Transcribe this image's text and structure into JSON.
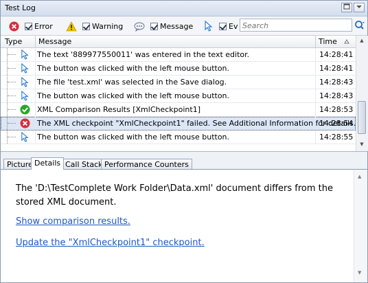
{
  "window": {
    "title": "Test Log"
  },
  "toolbar": {
    "filters": [
      {
        "label": "Error",
        "icon": "error-icon",
        "checked": true
      },
      {
        "label": "Warning",
        "icon": "warning-icon",
        "checked": true
      },
      {
        "label": "Message",
        "icon": "message-icon",
        "checked": true
      },
      {
        "label": "Ev",
        "icon": "event-icon",
        "checked": true
      }
    ],
    "search": {
      "placeholder": "Search",
      "value": ""
    }
  },
  "grid": {
    "columns": {
      "type": "Type",
      "message": "Message",
      "time": "Time"
    },
    "rows": [
      {
        "icon": "event-icon",
        "message": "The text '889977550011' was entered in the text editor.",
        "time": "14:28:41"
      },
      {
        "icon": "event-icon",
        "message": "The button was clicked with the left mouse button.",
        "time": "14:28:41"
      },
      {
        "icon": "event-icon",
        "message": "The file 'test.xml' was selected in the Save dialog.",
        "time": "14:28:43"
      },
      {
        "icon": "event-icon",
        "message": "The button was clicked with the left mouse button.",
        "time": "14:28:43"
      },
      {
        "icon": "checkpoint-pass-icon",
        "message": "XML Comparison Results [XmlCheckpoint1]",
        "time": "14:28:53"
      },
      {
        "icon": "error-icon",
        "message": "The XML checkpoint \"XmlCheckpoint1\" failed. See Additional Information for details.",
        "time": "14:28:54",
        "selected": true
      },
      {
        "icon": "event-icon",
        "message": "The button was clicked with the left mouse button.",
        "time": "14:28:55"
      }
    ]
  },
  "tabs": [
    {
      "label": "Picture"
    },
    {
      "label": "Details",
      "active": true
    },
    {
      "label": "Call Stack"
    },
    {
      "label": "Performance Counters"
    }
  ],
  "details": {
    "text": "The 'D:\\TestComplete Work Folder\\Data.xml' document differs from the stored XML document.",
    "link1": "Show comparison results.",
    "link2": "Update the \"XmlCheckpoint1\" checkpoint."
  },
  "colors": {
    "link": "#1f55c7",
    "error": "#d62f3a",
    "pass": "#2aa52a",
    "event": "#2f7fd0"
  }
}
